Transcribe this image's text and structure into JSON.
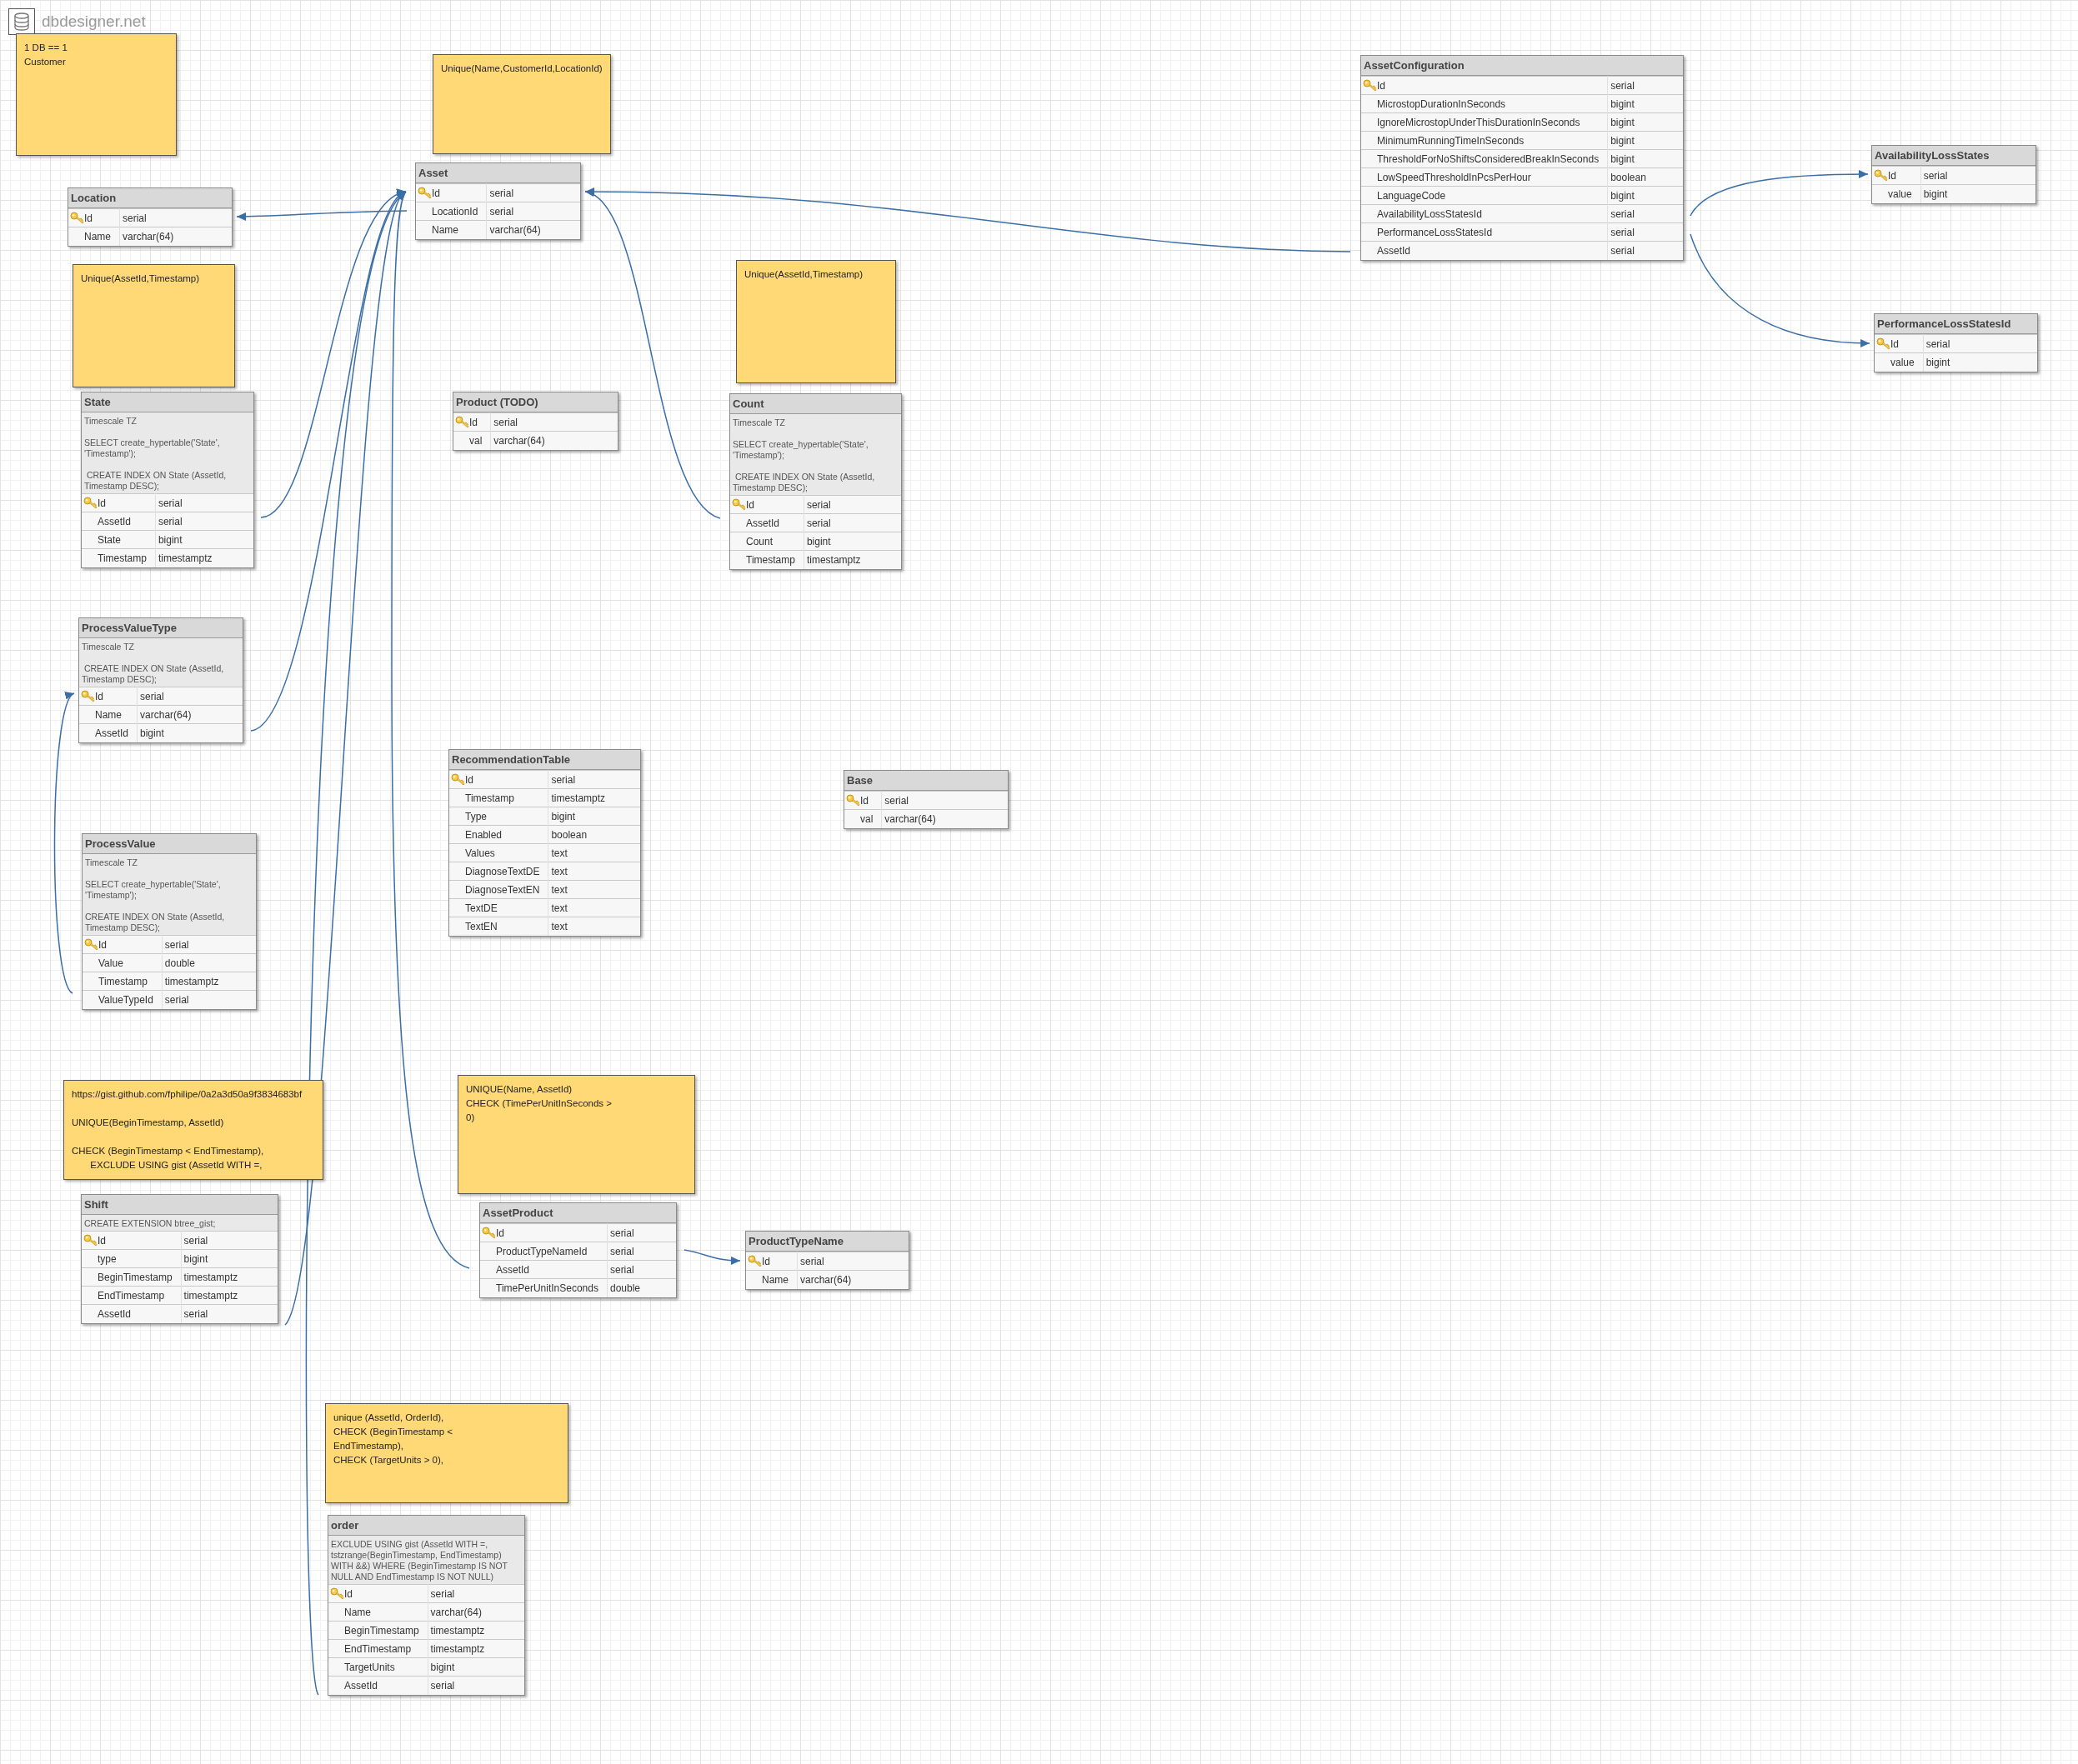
{
  "app": {
    "name": "dbdesigner.net"
  },
  "notes": [
    {
      "text": "1 DB == 1\nCustomer"
    },
    {
      "text": "Unique(Name,CustomerId,LocationId)"
    },
    {
      "text": "Unique(AssetId,Timestamp)"
    },
    {
      "text": "Unique(AssetId,Timestamp)"
    },
    {
      "text": "https://gist.github.com/fphilipe/0a2a3d50a9f3834683bf\n\nUNIQUE(BeginTimestamp, AssetId)\n\nCHECK (BeginTimestamp < EndTimestamp),\n       EXCLUDE USING gist (AssetId WITH =,"
    },
    {
      "text": "UNIQUE(Name, AssetId)\nCHECK (TimePerUnitInSeconds >\n0)"
    },
    {
      "text": "unique (AssetId, OrderId),\nCHECK (BeginTimestamp <\nEndTimestamp),\nCHECK (TargetUnits > 0),"
    }
  ],
  "tables": [
    {
      "name": "Location",
      "columns": [
        {
          "name": "Id",
          "type": "serial",
          "pk": true
        },
        {
          "name": "Name",
          "type": "varchar(64)",
          "pk": false
        }
      ]
    },
    {
      "name": "Asset",
      "columns": [
        {
          "name": "Id",
          "type": "serial",
          "pk": true
        },
        {
          "name": "LocationId",
          "type": "serial",
          "pk": false
        },
        {
          "name": "Name",
          "type": "varchar(64)",
          "pk": false
        }
      ]
    },
    {
      "name": "State",
      "comment": "Timescale TZ\n\nSELECT create_hypertable('State', 'Timestamp');\n\n CREATE INDEX ON State (AssetId, Timestamp DESC);",
      "columns": [
        {
          "name": "Id",
          "type": "serial",
          "pk": true
        },
        {
          "name": "AssetId",
          "type": "serial",
          "pk": false
        },
        {
          "name": "State",
          "type": "bigint",
          "pk": false
        },
        {
          "name": "Timestamp",
          "type": "timestamptz",
          "pk": false
        }
      ]
    },
    {
      "name": "Product (TODO)",
      "columns": [
        {
          "name": "Id",
          "type": "serial",
          "pk": true
        },
        {
          "name": "val",
          "type": "varchar(64)",
          "pk": false
        }
      ]
    },
    {
      "name": "Count",
      "comment": "Timescale TZ\n\nSELECT create_hypertable('State', 'Timestamp');\n\n CREATE INDEX ON State (AssetId, Timestamp DESC);",
      "columns": [
        {
          "name": "Id",
          "type": "serial",
          "pk": true
        },
        {
          "name": "AssetId",
          "type": "serial",
          "pk": false
        },
        {
          "name": "Count",
          "type": "bigint",
          "pk": false
        },
        {
          "name": "Timestamp",
          "type": "timestamptz",
          "pk": false
        }
      ]
    },
    {
      "name": "ProcessValueType",
      "comment": "Timescale TZ\n\n CREATE INDEX ON State (AssetId, Timestamp DESC);",
      "columns": [
        {
          "name": "Id",
          "type": "serial",
          "pk": true
        },
        {
          "name": "Name",
          "type": "varchar(64)",
          "pk": false
        },
        {
          "name": "AssetId",
          "type": "bigint",
          "pk": false
        }
      ]
    },
    {
      "name": "RecommendationTable",
      "columns": [
        {
          "name": "Id",
          "type": "serial",
          "pk": true
        },
        {
          "name": "Timestamp",
          "type": "timestamptz",
          "pk": false
        },
        {
          "name": "Type",
          "type": "bigint",
          "pk": false
        },
        {
          "name": "Enabled",
          "type": "boolean",
          "pk": false
        },
        {
          "name": "Values",
          "type": "text",
          "pk": false
        },
        {
          "name": "DiagnoseTextDE",
          "type": "text",
          "pk": false
        },
        {
          "name": "DiagnoseTextEN",
          "type": "text",
          "pk": false
        },
        {
          "name": "TextDE",
          "type": "text",
          "pk": false
        },
        {
          "name": "TextEN",
          "type": "text",
          "pk": false
        }
      ]
    },
    {
      "name": "Base",
      "columns": [
        {
          "name": "Id",
          "type": "serial",
          "pk": true
        },
        {
          "name": "val",
          "type": "varchar(64)",
          "pk": false
        }
      ]
    },
    {
      "name": "ProcessValue",
      "comment": "Timescale TZ\n\nSELECT create_hypertable('State', 'Timestamp');\n\nCREATE INDEX ON State (AssetId, Timestamp DESC);",
      "columns": [
        {
          "name": "Id",
          "type": "serial",
          "pk": true
        },
        {
          "name": "Value",
          "type": "double",
          "pk": false
        },
        {
          "name": "Timestamp",
          "type": "timestamptz",
          "pk": false
        },
        {
          "name": "ValueTypeId",
          "type": "serial",
          "pk": false
        }
      ]
    },
    {
      "name": "Shift",
      "comment": "CREATE EXTENSION btree_gist;\n",
      "columns": [
        {
          "name": "Id",
          "type": "serial",
          "pk": true
        },
        {
          "name": "type",
          "type": "bigint",
          "pk": false
        },
        {
          "name": "BeginTimestamp",
          "type": "timestamptz",
          "pk": false
        },
        {
          "name": "EndTimestamp",
          "type": "timestamptz",
          "pk": false
        },
        {
          "name": "AssetId",
          "type": "serial",
          "pk": false
        }
      ]
    },
    {
      "name": "AssetProduct",
      "columns": [
        {
          "name": "Id",
          "type": "serial",
          "pk": true
        },
        {
          "name": "ProductTypeNameId",
          "type": "serial",
          "pk": false
        },
        {
          "name": "AssetId",
          "type": "serial",
          "pk": false
        },
        {
          "name": "TimePerUnitInSeconds",
          "type": "double",
          "pk": false
        }
      ]
    },
    {
      "name": "ProductTypeName",
      "columns": [
        {
          "name": "Id",
          "type": "serial",
          "pk": true
        },
        {
          "name": "Name",
          "type": "varchar(64)",
          "pk": false
        }
      ]
    },
    {
      "name": "order",
      "comment": "EXCLUDE USING gist (AssetId WITH =, tstzrange(BeginTimestamp, EndTimestamp) WITH &&) WHERE (BeginTimestamp IS NOT NULL AND EndTimestamp IS NOT NULL)\n",
      "columns": [
        {
          "name": "Id",
          "type": "serial",
          "pk": true
        },
        {
          "name": "Name",
          "type": "varchar(64)",
          "pk": false
        },
        {
          "name": "BeginTimestamp",
          "type": "timestamptz",
          "pk": false
        },
        {
          "name": "EndTimestamp",
          "type": "timestamptz",
          "pk": false
        },
        {
          "name": "TargetUnits",
          "type": "bigint",
          "pk": false
        },
        {
          "name": "AssetId",
          "type": "serial",
          "pk": false
        }
      ]
    },
    {
      "name": "AssetConfiguration",
      "columns": [
        {
          "name": "Id",
          "type": "serial",
          "pk": true
        },
        {
          "name": "MicrostopDurationInSeconds",
          "type": "bigint",
          "pk": false
        },
        {
          "name": "IgnoreMicrostopUnderThisDurationInSeconds",
          "type": "bigint",
          "pk": false
        },
        {
          "name": "MinimumRunningTimeInSeconds",
          "type": "bigint",
          "pk": false
        },
        {
          "name": "ThresholdForNoShiftsConsideredBreakInSeconds",
          "type": "bigint",
          "pk": false
        },
        {
          "name": "LowSpeedThresholdInPcsPerHour",
          "type": "boolean",
          "pk": false
        },
        {
          "name": "LanguageCode",
          "type": "bigint",
          "pk": false
        },
        {
          "name": "AvailabilityLossStatesId",
          "type": "serial",
          "pk": false
        },
        {
          "name": "PerformanceLossStatesId",
          "type": "serial",
          "pk": false
        },
        {
          "name": "AssetId",
          "type": "serial",
          "pk": false
        }
      ]
    },
    {
      "name": "AvailabilityLossStates",
      "columns": [
        {
          "name": "Id",
          "type": "serial",
          "pk": true
        },
        {
          "name": "value",
          "type": "bigint",
          "pk": false
        }
      ]
    },
    {
      "name": "PerformanceLossStatesId",
      "columns": [
        {
          "name": "Id",
          "type": "serial",
          "pk": true
        },
        {
          "name": "value",
          "type": "bigint",
          "pk": false
        }
      ]
    }
  ]
}
